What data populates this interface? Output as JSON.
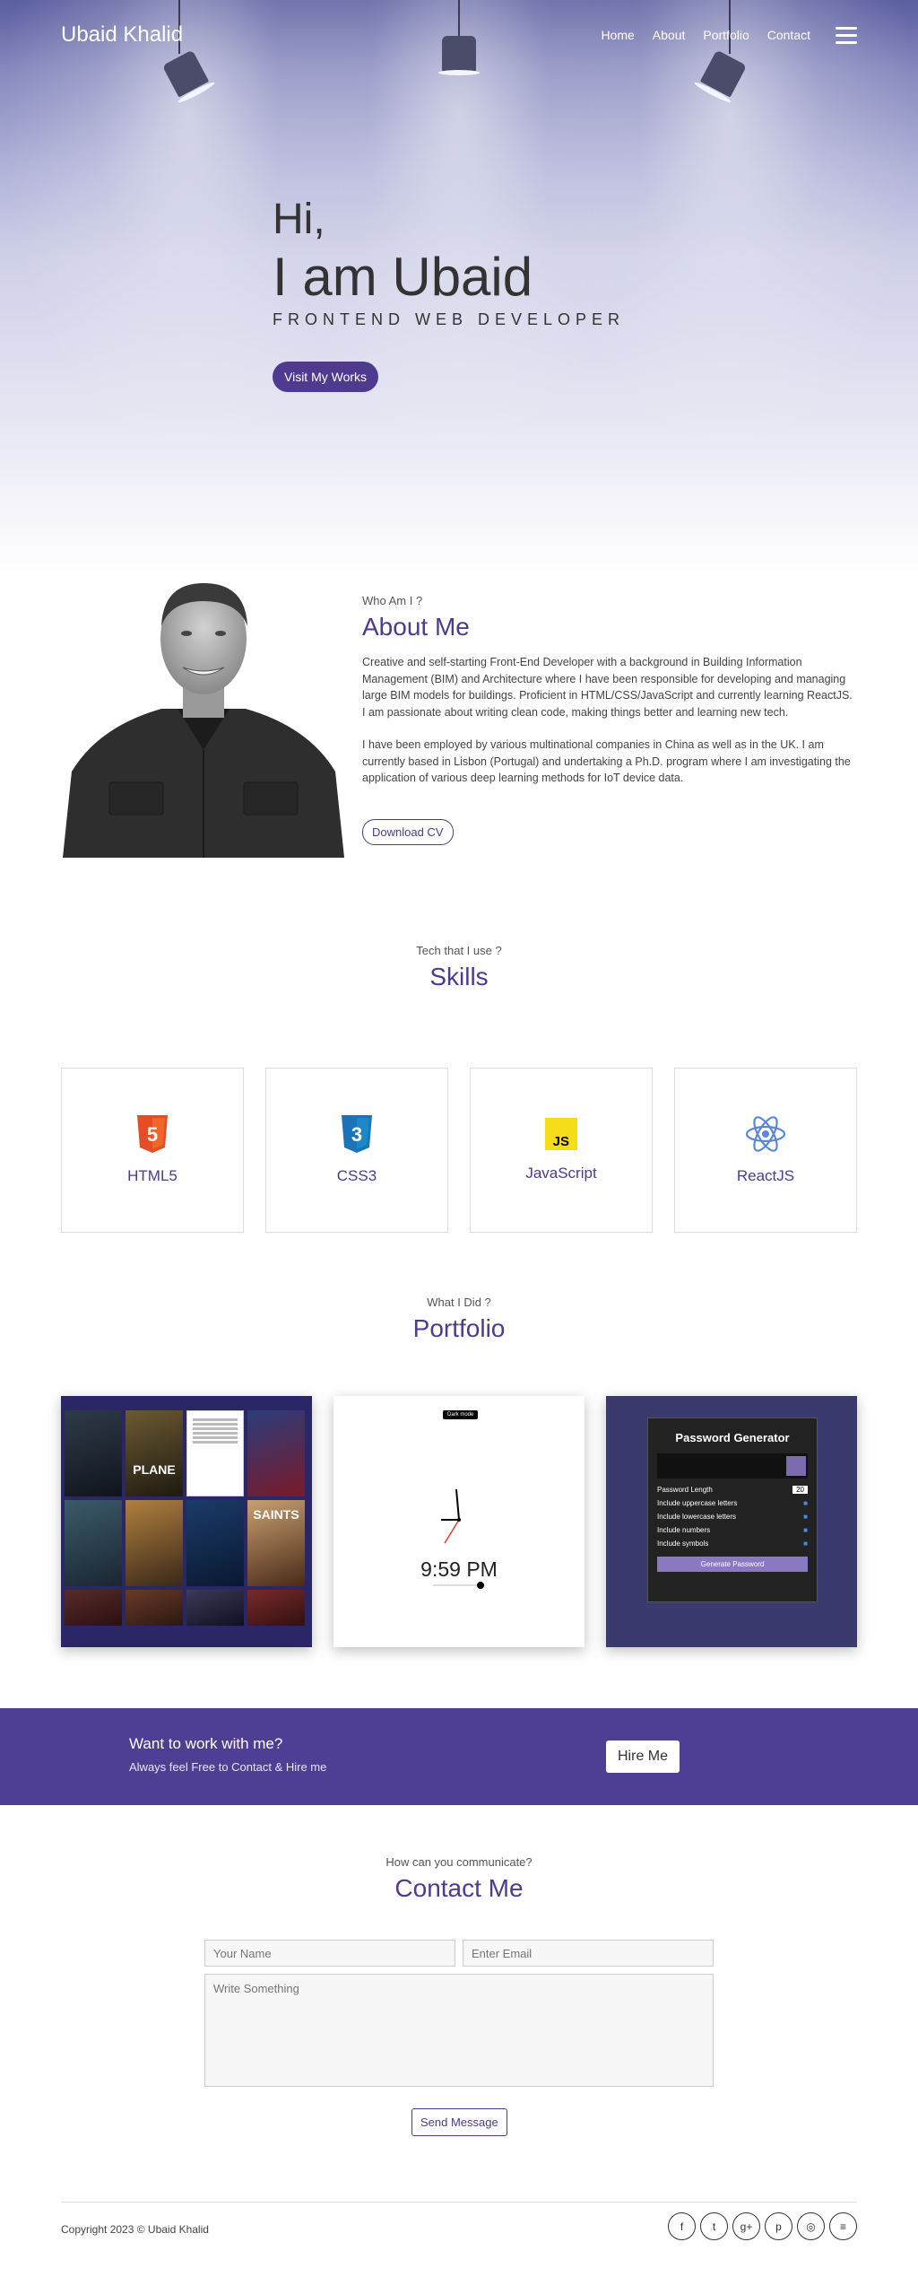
{
  "nav": {
    "brand": "Ubaid Khalid",
    "links": [
      "Home",
      "About",
      "Portfolio",
      "Contact"
    ]
  },
  "hero": {
    "greeting": "Hi,",
    "name": "I am Ubaid",
    "role": "FRONTEND WEB DEVELOPER",
    "cta": "Visit My Works"
  },
  "about": {
    "eyebrow": "Who Am I ?",
    "title": "About Me",
    "p1": "Creative and self-starting Front-End Developer with a background in Building Information Management (BIM) and Architecture where I have been responsible for developing and managing large BIM models for buildings. Proficient in HTML/CSS/JavaScript and currently learning ReactJS. I am passionate about writing clean code, making things better and learning new tech.",
    "p2": "I have been employed by various multinational companies in China as well as in the UK. I am currently based in Lisbon (Portugal) and undertaking a Ph.D. program where I am investigating the application of various deep learning methods for IoT device data.",
    "cv": "Download CV"
  },
  "skills": {
    "eyebrow": "Tech that I use ?",
    "title": "Skills",
    "items": [
      {
        "label": "HTML5",
        "icon": "html5-icon",
        "badge": "5",
        "color": "#e44d26"
      },
      {
        "label": "CSS3",
        "icon": "css3-icon",
        "badge": "3",
        "color": "#1b73ba"
      },
      {
        "label": "JavaScript",
        "icon": "javascript-icon",
        "badge": "JS",
        "color": "#f5de19"
      },
      {
        "label": "ReactJS",
        "icon": "react-icon",
        "badge": "",
        "color": "#5c86d6"
      }
    ]
  },
  "portfolio": {
    "eyebrow": "What I Did ?",
    "title": "Portfolio",
    "movies": {
      "posters": [
        "",
        "PLANE",
        "",
        "",
        "",
        "",
        "",
        "SAINTS",
        "",
        "",
        "",
        ""
      ],
      "captions": [
        "",
        "Plane",
        "",
        "",
        "",
        "",
        "",
        "",
        "",
        "",
        "",
        ""
      ]
    },
    "clock": {
      "time": "9:59 PM",
      "mode": "Dark mode"
    },
    "password": {
      "title": "Password Generator",
      "length_label": "Password Length",
      "length_value": "20",
      "options": [
        "Include uppercase letters",
        "Include lowercase letters",
        "Include numbers",
        "Include symbols"
      ],
      "button": "Generate Password"
    }
  },
  "cta": {
    "title": "Want to work with me?",
    "subtitle": "Always feel Free to Contact & Hire me",
    "button": "Hire Me"
  },
  "contact": {
    "eyebrow": "How can you communicate?",
    "title": "Contact Me",
    "name_placeholder": "Your Name",
    "email_placeholder": "Enter Email",
    "message_placeholder": "Write Something",
    "send": "Send Message"
  },
  "footer": {
    "copyright": "Copyright 2023 © Ubaid Khalid",
    "socials": [
      {
        "icon": "facebook-icon",
        "glyph": "f"
      },
      {
        "icon": "twitter-icon",
        "glyph": "t"
      },
      {
        "icon": "google-plus-icon",
        "glyph": "g+"
      },
      {
        "icon": "pinterest-icon",
        "glyph": "p"
      },
      {
        "icon": "instagram-icon",
        "glyph": "◎"
      },
      {
        "icon": "stackoverflow-icon",
        "glyph": "≡"
      }
    ]
  }
}
